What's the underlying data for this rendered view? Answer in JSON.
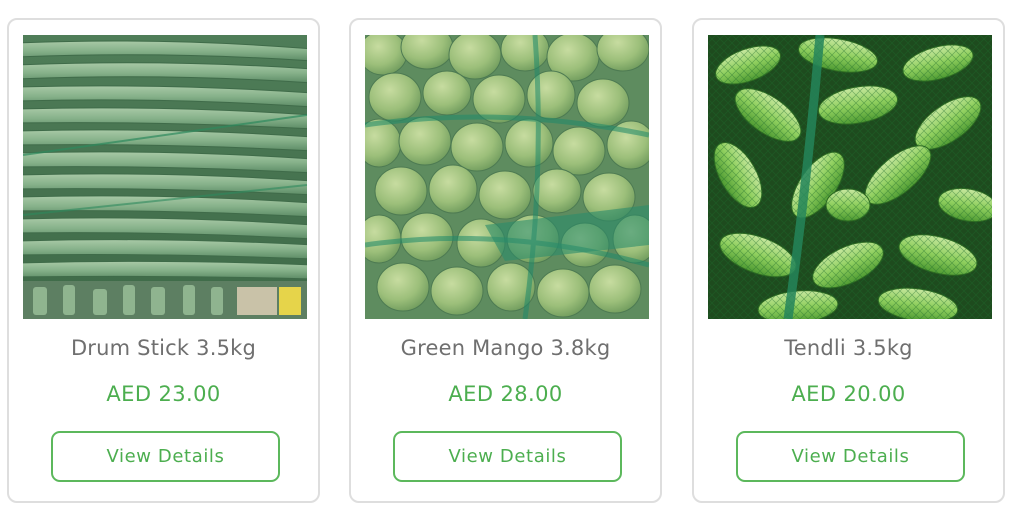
{
  "products": [
    {
      "name": "Drum Stick 3.5kg",
      "price": "AED 23.00",
      "button_label": "View Details",
      "image_icon": "drumstick-photo"
    },
    {
      "name": "Green Mango 3.8kg",
      "price": "AED 28.00",
      "button_label": "View Details",
      "image_icon": "green-mango-photo"
    },
    {
      "name": "Tendli 3.5kg",
      "price": "AED 20.00",
      "button_label": "View Details",
      "image_icon": "tendli-photo"
    }
  ],
  "colors": {
    "accent_green": "#4cae4f",
    "title_gray": "#6f6f6f",
    "card_border": "#dedede"
  }
}
